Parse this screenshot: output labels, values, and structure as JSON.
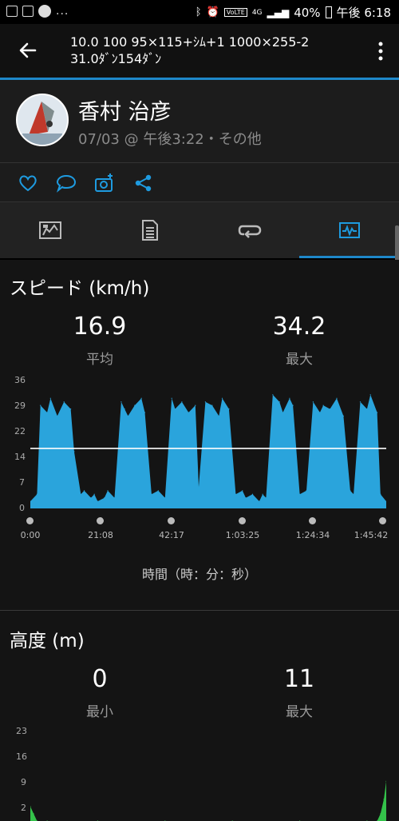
{
  "status": {
    "battery": "40%",
    "time": "午後 6:18",
    "dots": "...",
    "network": "4G",
    "lte": "VoLTE"
  },
  "appbar": {
    "title_line1": "10.0 100 95×115+ｼﾑ+1 1000×255-2",
    "title_line2": "31.0ﾀﾞﾝ154ﾀﾞﾝ"
  },
  "activity": {
    "name": "香村 治彦",
    "meta": "07/03 @ 午後3:22・その他"
  },
  "speed": {
    "title": "スピード (km/h)",
    "avg_value": "16.9",
    "avg_label": "平均",
    "max_value": "34.2",
    "max_label": "最大",
    "x_axis_label": "時間（時：分：秒）"
  },
  "altitude": {
    "title": "高度 (m)",
    "min_value": "0",
    "min_label": "最小",
    "max_value": "11",
    "max_label": "最大"
  },
  "chart_data": [
    {
      "type": "area",
      "ylim": [
        0,
        36
      ],
      "yticks": [
        "36",
        "29",
        "22",
        "14",
        "7",
        "0"
      ],
      "xticks": [
        "0:00",
        "21:08",
        "42:17",
        "1:03:25",
        "1:24:34",
        "1:45:42"
      ],
      "xlabel": "時間（時：分：秒）",
      "average_line": 16.9,
      "color": "#2aa4dc",
      "x": [
        0,
        2,
        3,
        5,
        6,
        8,
        10,
        12,
        13,
        15,
        16,
        18,
        19,
        20,
        22,
        23,
        25,
        27,
        28,
        29,
        31,
        33,
        34,
        36,
        38,
        40,
        42,
        43,
        45,
        47,
        49,
        50,
        52,
        54,
        56,
        57,
        59,
        61,
        63,
        64,
        66,
        68,
        69,
        70,
        72,
        74,
        75,
        77,
        78,
        80,
        82,
        84,
        86,
        87,
        89,
        91,
        93,
        95,
        96,
        98,
        100,
        101,
        103,
        104,
        105.7
      ],
      "values": [
        2,
        4,
        29,
        27,
        31,
        26,
        30,
        28,
        16,
        4,
        5,
        3,
        4,
        2,
        3,
        5,
        3,
        30,
        28,
        26,
        29,
        31,
        27,
        4,
        5,
        3,
        31,
        28,
        30,
        27,
        29,
        6,
        30,
        29,
        26,
        31,
        28,
        4,
        5,
        3,
        4,
        2,
        4,
        3,
        32,
        30,
        27,
        31,
        29,
        4,
        5,
        30,
        27,
        29,
        28,
        31,
        26,
        5,
        4,
        30,
        28,
        32,
        27,
        4,
        2
      ]
    },
    {
      "type": "area",
      "ylim": [
        0,
        23
      ],
      "yticks": [
        "23",
        "16",
        "9",
        "2"
      ],
      "color": "#34c24a",
      "x": [
        0,
        1,
        2,
        5,
        20,
        40,
        60,
        80,
        100,
        103,
        104,
        105,
        105.7
      ],
      "values": [
        4,
        2,
        0,
        0,
        0,
        0,
        0,
        0,
        0,
        0,
        2,
        6,
        11
      ]
    }
  ]
}
